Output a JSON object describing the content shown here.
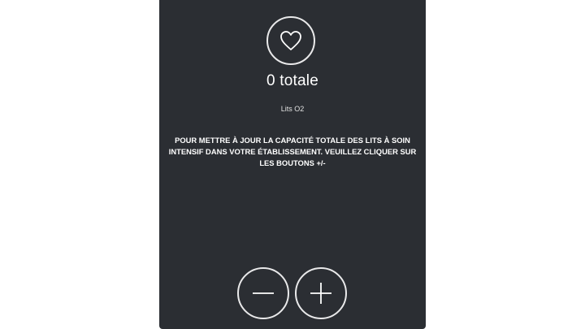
{
  "counter": {
    "total_text": "0 totale",
    "caption": "Lits O2",
    "icon": "heart-icon"
  },
  "instructions": {
    "text": "POUR METTRE À JOUR LA CAPACITÉ TOTALE DES LITS À SOIN INTENSIF DANS VOTRE ÉTABLISSEMENT. VEUILLEZ CLIQUER SUR LES BOUTONS +/-"
  },
  "controls": {
    "decrement_icon": "minus-icon",
    "increment_icon": "plus-icon"
  },
  "colors": {
    "panel_background": "#2b2e33",
    "foreground": "#ffffff",
    "page_background": "#ffffff"
  }
}
